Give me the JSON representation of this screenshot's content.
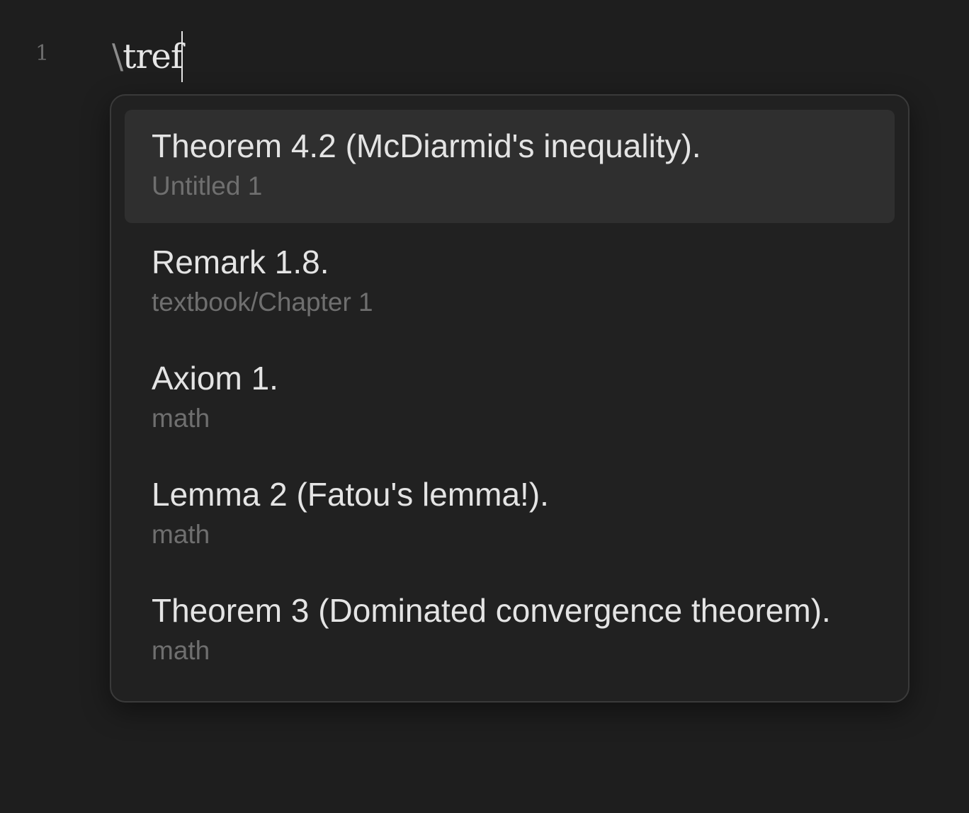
{
  "editor": {
    "line_number": "1",
    "command_backslash": "\\",
    "command_text": "tref"
  },
  "suggestions": [
    {
      "title": "Theorem 4.2 (McDiarmid's inequality).",
      "source": "Untitled 1",
      "selected": true
    },
    {
      "title": "Remark 1.8.",
      "source": "textbook/Chapter 1",
      "selected": false
    },
    {
      "title": "Axiom 1.",
      "source": "math",
      "selected": false
    },
    {
      "title": "Lemma 2 (Fatou's lemma!).",
      "source": "math",
      "selected": false
    },
    {
      "title": "Theorem 3 (Dominated convergence theorem).",
      "source": "math",
      "selected": false
    }
  ]
}
